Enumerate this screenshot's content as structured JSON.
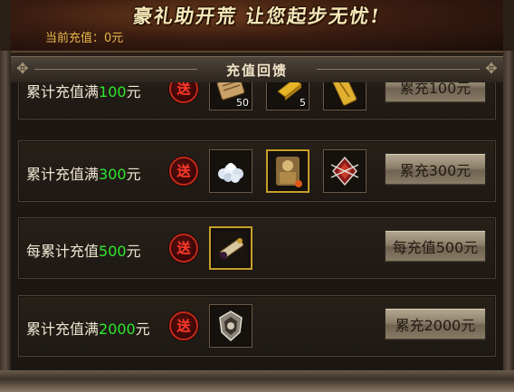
{
  "banner": {
    "slogan": "豪礼助开荒 让您起步无忧!",
    "current_recharge": "当前充值：0元"
  },
  "title": "充值回馈",
  "rows": [
    {
      "prefix": "累计充值满",
      "amount": "100",
      "suffix": "元",
      "badge": "送",
      "button": "累充100元",
      "items": [
        {
          "icon": "scroll-bundle-icon",
          "count": "50"
        },
        {
          "icon": "gold-bar-icon",
          "count": "5"
        },
        {
          "icon": "golden-scroll-icon",
          "count": ""
        }
      ]
    },
    {
      "prefix": "累计充值满",
      "amount": "300",
      "suffix": "元",
      "badge": "送",
      "button": "累充300元",
      "items": [
        {
          "icon": "silver-pile-icon",
          "count": ""
        },
        {
          "icon": "golden-warrior-icon",
          "count": ""
        },
        {
          "icon": "red-emblem-icon",
          "count": ""
        }
      ]
    },
    {
      "prefix": "每累计充值",
      "amount": "500",
      "suffix": "元",
      "badge": "送",
      "button": "每充值500元",
      "items": [
        {
          "icon": "treasure-scroll-icon",
          "count": ""
        }
      ]
    },
    {
      "prefix": "累计充值满",
      "amount": "2000",
      "suffix": "元",
      "badge": "送",
      "button": "累充2000元",
      "items": [
        {
          "icon": "silver-crest-icon",
          "count": ""
        }
      ]
    }
  ],
  "colors": {
    "amount_green": "#2ee82e",
    "badge_red": "#ff3a28",
    "current_recharge_gold": "#e8b84a"
  }
}
